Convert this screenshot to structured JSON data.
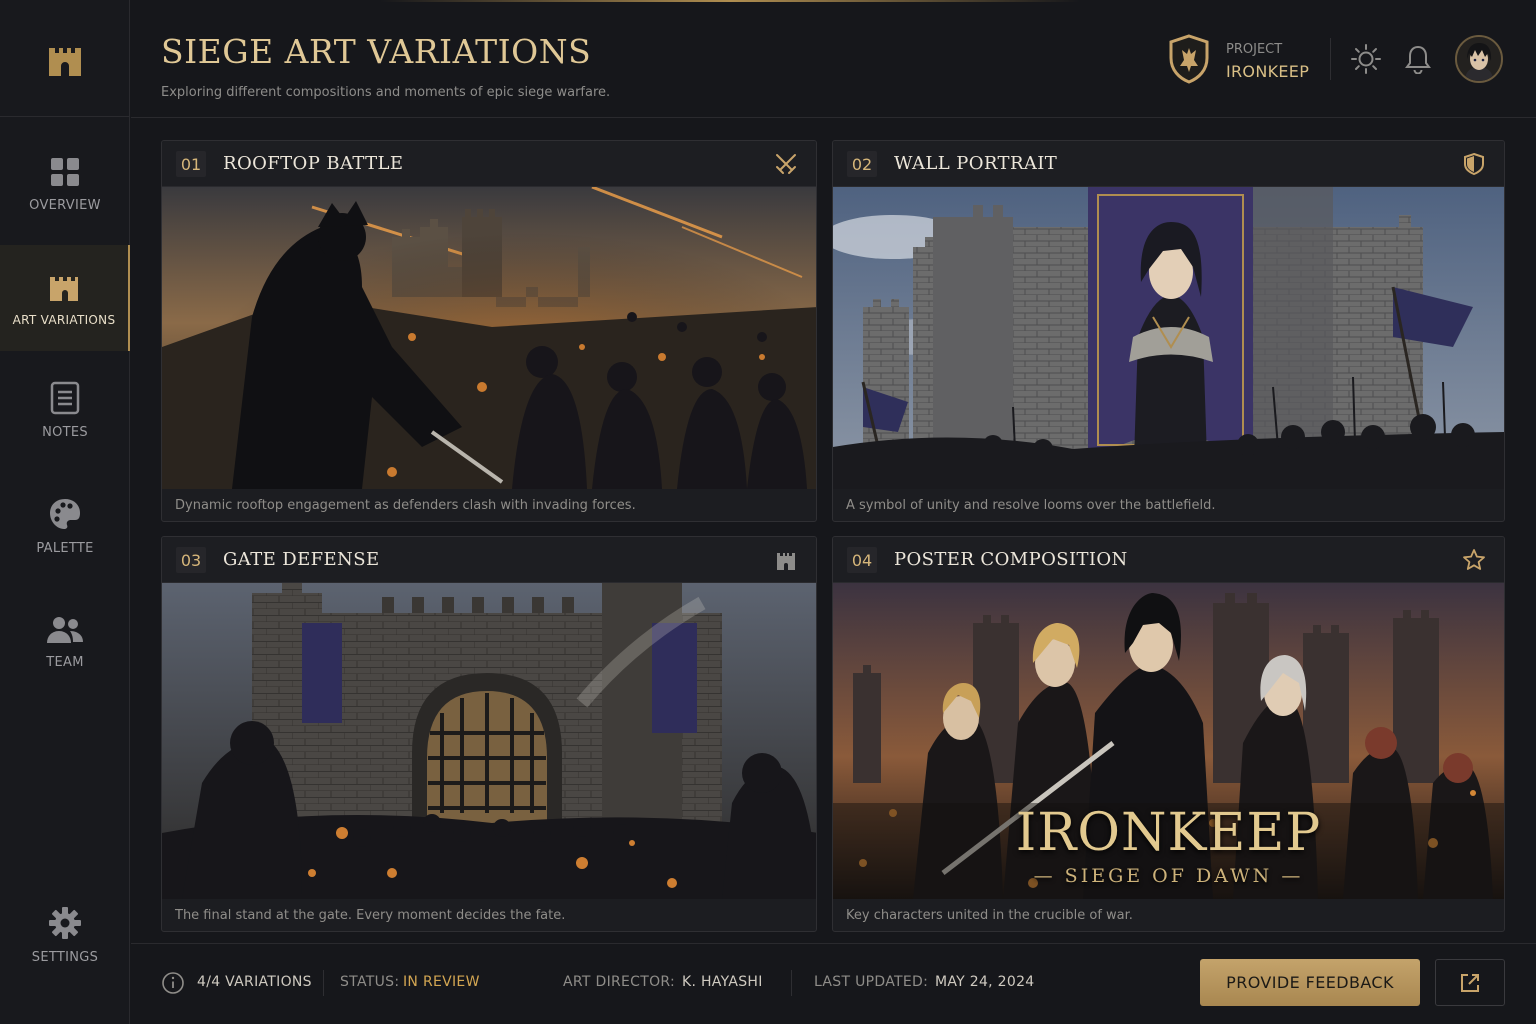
{
  "colors": {
    "accent": "#b08e50",
    "gold_text": "#e0c896",
    "status": "#d3a652",
    "bg": "#16171b"
  },
  "sidebar": {
    "logo_icon": "castle-icon",
    "items": [
      {
        "label": "OVERVIEW",
        "icon": "grid-icon"
      },
      {
        "label": "ART VARIATIONS",
        "icon": "castle-icon",
        "active": true
      },
      {
        "label": "NOTES",
        "icon": "document-icon"
      },
      {
        "label": "PALETTE",
        "icon": "palette-icon"
      },
      {
        "label": "TEAM",
        "icon": "people-icon"
      }
    ],
    "settings": {
      "label": "SETTINGS",
      "icon": "gear-icon"
    }
  },
  "header": {
    "title": "SIEGE ART VARIATIONS",
    "subtitle": "Exploring different compositions and moments of epic siege warfare.",
    "project_label": "PROJECT",
    "project_name": "IRONKEEP",
    "icons": [
      "shield-crest-icon",
      "sun-icon",
      "bell-icon",
      "avatar"
    ]
  },
  "cards": [
    {
      "num": "01",
      "title": "ROOFTOP BATTLE",
      "icon": "crossed-swords-icon",
      "caption": "Dynamic rooftop engagement as defenders clash with invading forces."
    },
    {
      "num": "02",
      "title": "WALL PORTRAIT",
      "icon": "shield-icon",
      "caption": "A symbol of unity and resolve looms over the battlefield."
    },
    {
      "num": "03",
      "title": "GATE DEFENSE",
      "icon": "tower-icon",
      "caption": "The final stand at the gate. Every moment decides the fate."
    },
    {
      "num": "04",
      "title": "POSTER COMPOSITION",
      "icon": "star-icon",
      "caption": "Key characters united in the crucible of war.",
      "poster_title": "IRONKEEP",
      "poster_subtitle": "— SIEGE OF DAWN —"
    }
  ],
  "footer": {
    "variations": "4/4 VARIATIONS",
    "status_label": "STATUS:",
    "status_value": "IN REVIEW",
    "director_label": "ART DIRECTOR:",
    "director_value": "K. HAYASHI",
    "updated_label": "LAST UPDATED:",
    "updated_value": "MAY 24, 2024",
    "feedback_button": "PROVIDE FEEDBACK",
    "external_icon": "external-link-icon"
  }
}
